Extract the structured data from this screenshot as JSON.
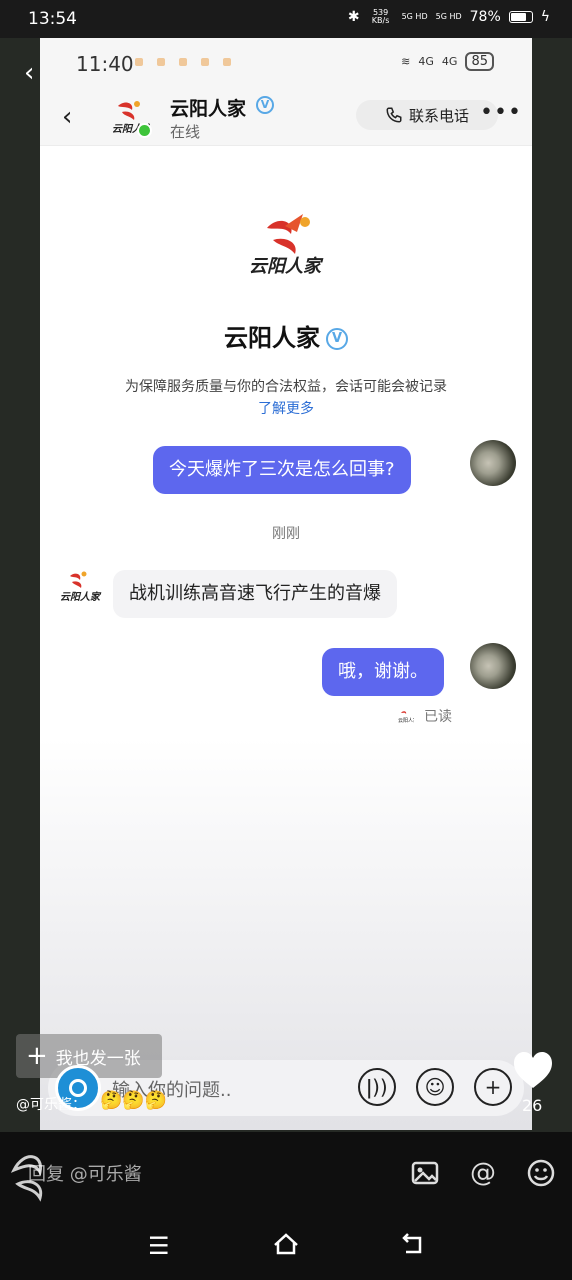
{
  "os_status": {
    "time": "13:54",
    "net_speed": "539 KB/s",
    "signal_1": "5G HD",
    "signal_2": "5G HD",
    "battery": "78%"
  },
  "inner_status": {
    "time": "11:40",
    "net_1": "4G",
    "net_2": "4G",
    "battery": "85"
  },
  "header": {
    "name": "云阳人家",
    "verified_badge": "V",
    "status": "在线",
    "call_label": "联系电话",
    "more_label": "•••"
  },
  "intro": {
    "name": "云阳人家",
    "notice": "为保障服务质量与你的合法权益，会话可能会被记录",
    "learn_more": "了解更多"
  },
  "messages": [
    {
      "from": "me",
      "text": "今天爆炸了三次是怎么回事?"
    },
    {
      "from": "separator",
      "text": "刚刚"
    },
    {
      "from": "shop",
      "text": "战机训练高音速飞行产生的音爆"
    },
    {
      "from": "me",
      "text": "哦，谢谢。"
    }
  ],
  "read_receipt": "已读",
  "input": {
    "placeholder": "输入你的问题.."
  },
  "overlay": {
    "post_button": "我也发一张",
    "commenter": "@可乐酱：",
    "emojis": "🤔🤔🤔",
    "like_count": "26"
  },
  "bottom": {
    "reply_placeholder": "回复 @可乐酱"
  },
  "colors": {
    "bubble_me": "#5d67ee",
    "online": "#3ec43a",
    "link": "#2c6ed5"
  },
  "icons": [
    "back-icon",
    "phone-icon",
    "more-icon",
    "voice-icon",
    "emoji-icon",
    "plus-icon",
    "heart-icon",
    "image-icon",
    "at-icon",
    "menu-icon",
    "home-icon",
    "return-icon"
  ]
}
